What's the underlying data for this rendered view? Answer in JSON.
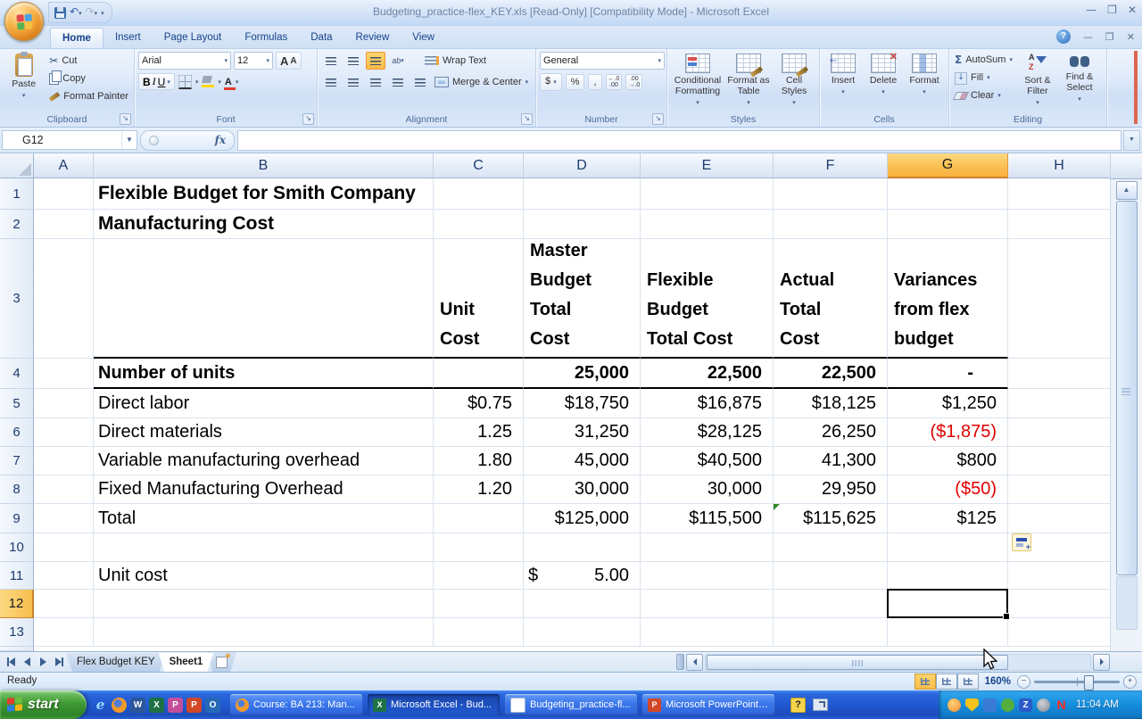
{
  "window": {
    "title": "Budgeting_practice-flex_KEY.xls  [Read-Only]  [Compatibility Mode] - Microsoft Excel"
  },
  "ribbon": {
    "tabs": [
      "Home",
      "Insert",
      "Page Layout",
      "Formulas",
      "Data",
      "Review",
      "View"
    ],
    "active_tab": "Home",
    "clipboard": {
      "label": "Clipboard",
      "paste": "Paste",
      "cut": "Cut",
      "copy": "Copy",
      "format_painter": "Format Painter"
    },
    "font": {
      "label": "Font",
      "family": "Arial",
      "size": "12",
      "bold": "B",
      "italic": "I",
      "underline": "U",
      "grow_font": "A",
      "shrink_font": "A"
    },
    "alignment": {
      "label": "Alignment",
      "wrap_text": "Wrap Text",
      "merge_center": "Merge & Center",
      "orientation": "ab"
    },
    "number": {
      "label": "Number",
      "format": "General",
      "currency": "$",
      "percent": "%",
      "comma": ","
    },
    "styles": {
      "label": "Styles",
      "conditional_formatting": "Conditional Formatting",
      "format_as_table": "Format as Table",
      "cell_styles": "Cell Styles"
    },
    "cells": {
      "label": "Cells",
      "insert": "Insert",
      "delete": "Delete",
      "format": "Format"
    },
    "editing": {
      "label": "Editing",
      "sigma": "Σ",
      "autosum": "AutoSum",
      "fill": "Fill",
      "clear": "Clear",
      "sort_filter": "Sort & Filter",
      "find_select": "Find & Select",
      "az_a": "A",
      "az_z": "Z"
    }
  },
  "formula_bar": {
    "name_box": "G12",
    "fx": "fx",
    "formula": ""
  },
  "grid": {
    "columns": [
      "A",
      "B",
      "C",
      "D",
      "E",
      "F",
      "G",
      "H"
    ],
    "selected_column": "G",
    "selected_row": "12",
    "active_cell": "G12",
    "rows": [
      {
        "n": "1",
        "cells": {
          "B": {
            "t": "Flexible Budget for Smith Company",
            "b": true,
            "ovf": true
          }
        }
      },
      {
        "n": "2",
        "cells": {
          "B": {
            "t": "Manufacturing Cost",
            "b": true,
            "ovf": true
          }
        }
      },
      {
        "n": "3",
        "bb": true,
        "cells": {
          "C": {
            "lines": [
              "Unit",
              "Cost"
            ]
          },
          "D": {
            "lines": [
              "Master",
              "Budget",
              "Total",
              "Cost"
            ]
          },
          "E": {
            "lines": [
              "Flexible",
              "Budget",
              "Total Cost"
            ]
          },
          "F": {
            "lines": [
              "Actual",
              "Total",
              "Cost"
            ]
          },
          "G": {
            "lines": [
              "Variances",
              "from flex",
              "budget"
            ]
          }
        }
      },
      {
        "n": "4",
        "bb": true,
        "cells": {
          "B": {
            "t": "Number of units",
            "b": true
          },
          "D": {
            "t": "25,000",
            "b": true,
            "r": true
          },
          "E": {
            "t": "22,500",
            "b": true,
            "r": true
          },
          "F": {
            "t": "22,500",
            "b": true,
            "r": true
          },
          "G": {
            "t": "-",
            "b": true,
            "r": true,
            "pad": 38
          }
        }
      },
      {
        "n": "5",
        "cells": {
          "B": {
            "t": "Direct labor"
          },
          "C": {
            "t": "$0.75",
            "r": true
          },
          "D": {
            "t": "$18,750",
            "r": true
          },
          "E": {
            "t": "$16,875",
            "r": true
          },
          "F": {
            "t": "$18,125",
            "r": true
          },
          "G": {
            "t": "$1,250",
            "r": true
          }
        }
      },
      {
        "n": "6",
        "cells": {
          "B": {
            "t": "Direct materials"
          },
          "C": {
            "t": "1.25",
            "r": true
          },
          "D": {
            "t": "31,250",
            "r": true
          },
          "E": {
            "t": "$28,125",
            "r": true
          },
          "F": {
            "t": "26,250",
            "r": true
          },
          "G": {
            "t": "($1,875)",
            "r": true,
            "red": true
          }
        }
      },
      {
        "n": "7",
        "cells": {
          "B": {
            "t": "Variable manufacturing overhead"
          },
          "C": {
            "t": "1.80",
            "r": true
          },
          "D": {
            "t": "45,000",
            "r": true
          },
          "E": {
            "t": "$40,500",
            "r": true
          },
          "F": {
            "t": "41,300",
            "r": true
          },
          "G": {
            "t": "$800",
            "r": true
          }
        }
      },
      {
        "n": "8",
        "cells": {
          "B": {
            "t": "Fixed Manufacturing Overhead"
          },
          "C": {
            "t": "1.20",
            "r": true
          },
          "D": {
            "t": "30,000",
            "r": true
          },
          "E": {
            "t": "30,000",
            "r": true
          },
          "F": {
            "t": "29,950",
            "r": true
          },
          "G": {
            "t": "($50)",
            "r": true,
            "red": true
          }
        }
      },
      {
        "n": "9",
        "cells": {
          "B": {
            "t": "Total"
          },
          "D": {
            "t": "$125,000",
            "r": true
          },
          "E": {
            "t": "$115,500",
            "r": true
          },
          "F": {
            "t": "$115,625",
            "r": true,
            "tri": true
          },
          "G": {
            "t": "$125",
            "r": true
          }
        }
      },
      {
        "n": "10",
        "cells": {}
      },
      {
        "n": "11",
        "cells": {
          "B": {
            "t": "Unit cost"
          },
          "D": {
            "acct": {
              "cur": "$",
              "val": "5.00"
            }
          }
        }
      },
      {
        "n": "12",
        "cells": {
          "G": {
            "sel": true
          }
        }
      },
      {
        "n": "13",
        "cells": {}
      }
    ]
  },
  "sheet_tabs": {
    "tabs": [
      {
        "label": "Flex Budget KEY",
        "active": false
      },
      {
        "label": "Sheet1",
        "active": true
      }
    ]
  },
  "status_bar": {
    "mode": "Ready",
    "zoom": "160%"
  },
  "taskbar": {
    "start_label": "start",
    "quick_launch": [
      "internet-explorer-icon",
      "firefox-icon",
      "word-icon",
      "excel-icon",
      "publisher-icon",
      "powerpoint-icon",
      "outlook-icon"
    ],
    "tasks": [
      {
        "label": "Course: BA 213: Man...",
        "icon": "firefox",
        "active": false
      },
      {
        "label": "Microsoft Excel - Bud...",
        "icon": "excel",
        "active": true
      },
      {
        "label": "Budgeting_practice-fl...",
        "icon": "document",
        "active": false
      },
      {
        "label": "Microsoft PowerPoint ...",
        "icon": "powerpoint",
        "active": false
      }
    ],
    "tray_icons": [
      "messenger-icon",
      "shield-icon",
      "network-icon",
      "antivirus-icon",
      "zone-icon",
      "volume-icon",
      "norton-icon"
    ],
    "clock": "11:04 AM"
  }
}
